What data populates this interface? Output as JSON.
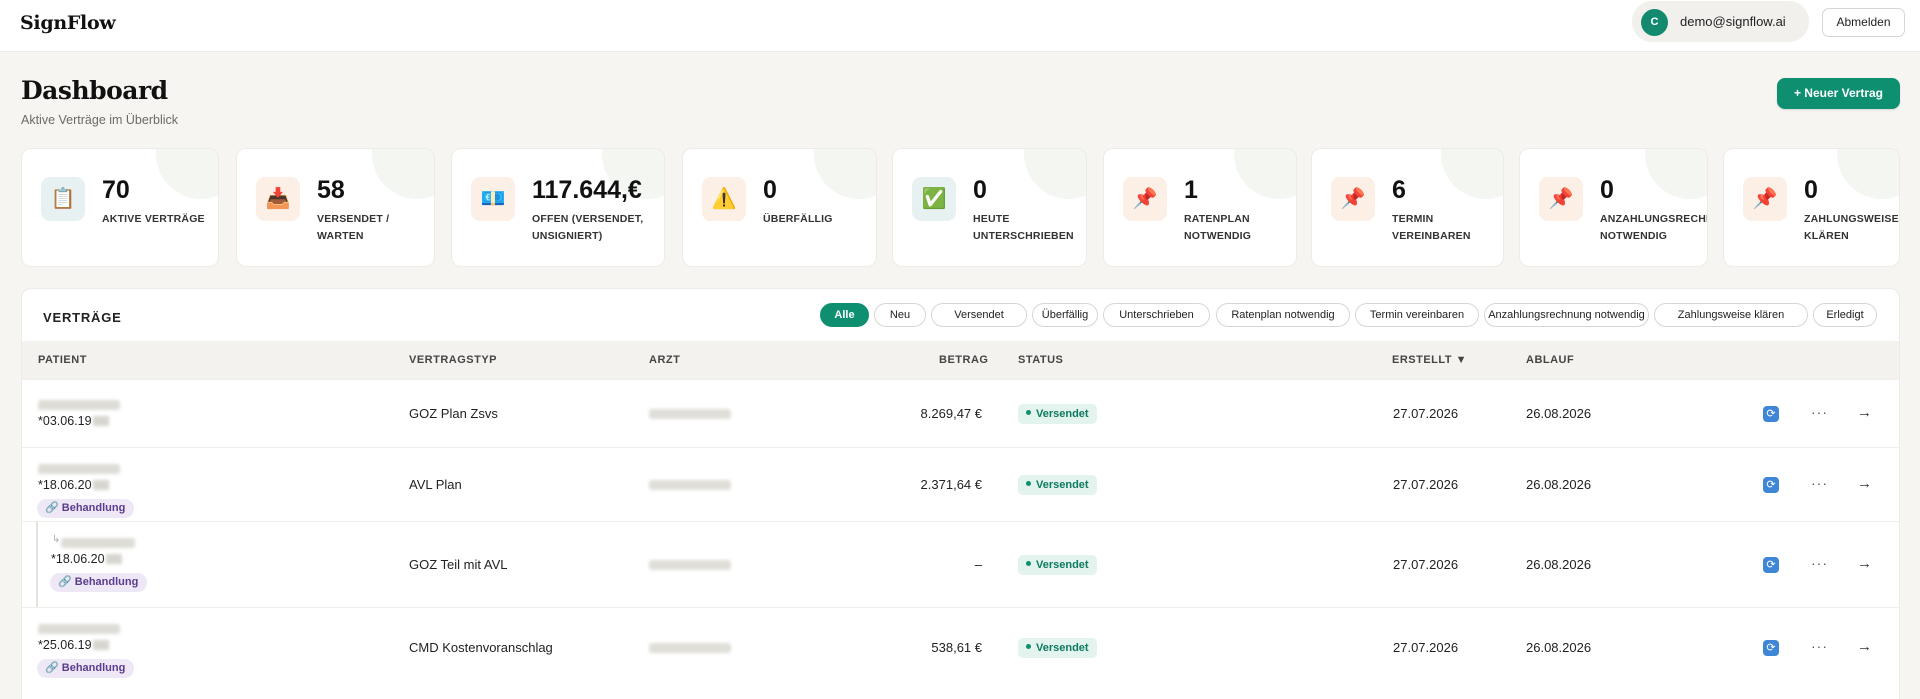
{
  "app": {
    "name": "SignFlow"
  },
  "user": {
    "initial": "C",
    "email": "demo@signflow.ai",
    "logout_label": "Abmelden"
  },
  "header": {
    "title": "Dashboard",
    "subtitle": "Aktive Verträge im Überblick",
    "new_button": "+ Neuer Vertrag"
  },
  "stats": [
    {
      "value": "70",
      "label": "AKTIVE VERTRÄGE",
      "icon": "clipboard-icon",
      "glyph": "📋",
      "tint": "#e7f1f1"
    },
    {
      "value": "58",
      "label": "VERSENDET /\nWARTEN",
      "icon": "inbox-tray-icon",
      "glyph": "📥",
      "tint": "#fbefe6"
    },
    {
      "value": "117.644,€",
      "label": "OFFEN (VERSENDET,\nUNSIGNIERT)",
      "icon": "money-icon",
      "glyph": "💶",
      "tint": "#fbefe6"
    },
    {
      "value": "0",
      "label": "ÜBERFÄLLIG",
      "icon": "warning-icon",
      "glyph": "⚠️",
      "tint": "#fbefe6"
    },
    {
      "value": "0",
      "label": "HEUTE\nUNTERSCHRIEBEN",
      "icon": "check-icon",
      "glyph": "✅",
      "tint": "#e7f1f1"
    },
    {
      "value": "1",
      "label": "RATENPLAN\nNOTWENDIG",
      "icon": "pushpin-icon",
      "glyph": "📌",
      "tint": "#fbefe6"
    },
    {
      "value": "6",
      "label": "TERMIN\nVEREINBAREN",
      "icon": "pushpin-icon",
      "glyph": "📌",
      "tint": "#fbefe6"
    },
    {
      "value": "0",
      "label": "ANZAHLUNGSRECHNUNG\nNOTWENDIG",
      "icon": "pushpin-icon",
      "glyph": "📌",
      "tint": "#fbefe6"
    },
    {
      "value": "0",
      "label": "ZAHLUNGSWEISE\nKLÄREN",
      "icon": "pushpin-icon",
      "glyph": "📌",
      "tint": "#fbefe6"
    }
  ],
  "contracts": {
    "title": "VERTRÄGE",
    "filters": [
      "Alle",
      "Neu",
      "Versendet",
      "Überfällig",
      "Unterschrieben",
      "Ratenplan notwendig",
      "Termin vereinbaren",
      "Anzahlungsrechnung notwendig",
      "Zahlungsweise klären",
      "Erledigt"
    ],
    "active_filter": "Alle",
    "columns": {
      "patient": "PATIENT",
      "type": "VERTRAGSTYP",
      "doctor": "ARZT",
      "amount": "BETRAG",
      "status": "STATUS",
      "created": "ERSTELLT ▼",
      "expires": "ABLAUF"
    },
    "rows": [
      {
        "dob": "*03.06.19",
        "type": "GOZ Plan Zsvs",
        "amount": "8.269,47 €",
        "status": "Versendet",
        "created": "27.07.2026",
        "expires": "26.08.2026",
        "tag": "",
        "child": false
      },
      {
        "dob": "*18.06.20",
        "type": "AVL Plan",
        "amount": "2.371,64 €",
        "status": "Versendet",
        "created": "27.07.2026",
        "expires": "26.08.2026",
        "tag": "🔗 Behandlung",
        "child": false
      },
      {
        "dob": "*18.06.20",
        "type": "GOZ Teil mit AVL",
        "amount": "–",
        "status": "Versendet",
        "created": "27.07.2026",
        "expires": "26.08.2026",
        "tag": "🔗 Behandlung",
        "child": true
      },
      {
        "dob": "*25.06.19",
        "type": "CMD Kostenvoranschlag",
        "amount": "538,61 €",
        "status": "Versendet",
        "created": "27.07.2026",
        "expires": "26.08.2026",
        "tag": "🔗 Behandlung",
        "child": false
      }
    ]
  },
  "icons": {
    "sync": "sync-icon",
    "more": "more-icon",
    "open": "arrow-right-icon"
  },
  "colors": {
    "accent": "#0e8f70",
    "status_bg": "#e3f3ed",
    "tag_bg": "#ede7f6"
  }
}
